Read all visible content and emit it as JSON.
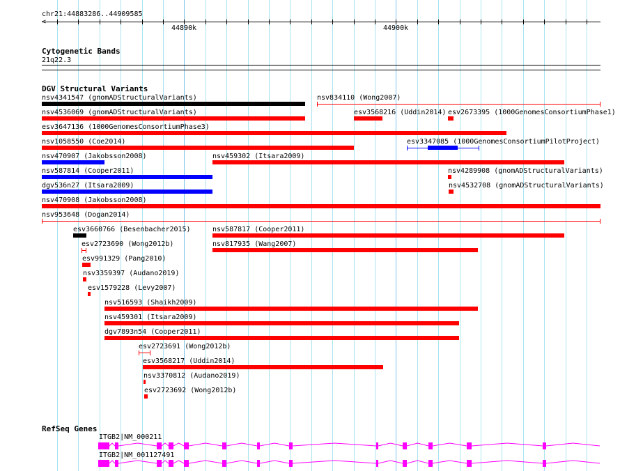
{
  "ruler": {
    "location": "chr21:44883286..44909585",
    "tick_labels": [
      "44890k",
      "44900k"
    ]
  },
  "tracks": {
    "cytoband": {
      "title": "Cytogenetic Bands",
      "band": "21q22.3"
    },
    "dgv": {
      "title": "DGV Structural Variants",
      "features": [
        "nsv4341547 (gnomADStructuralVariants)",
        "nsv834110 (Wong2007)",
        "nsv4536069 (gnomADStructuralVariants)",
        "esv3568216 (Uddin2014)",
        "esv2673395 (1000GenomesConsortiumPhase1)",
        "esv3647136 (1000GenomesConsortiumPhase3)",
        "nsv1058550 (Coe2014)",
        "esv3347085 (1000GenomesConsortiumPilotProject)",
        "nsv470907 (Jakobsson2008)",
        "nsv459302 (Itsara2009)",
        "nsv587814 (Cooper2011)",
        "nsv4289908 (gnomADStructuralVariants)",
        "dgv536n27 (Itsara2009)",
        "nsv4532708 (gnomADStructuralVariants)",
        "nsv470908 (Jakobsson2008)",
        "nsv953648 (Dogan2014)",
        "esv3660766 (Besenbacher2015)",
        "nsv587817 (Cooper2011)",
        "esv2723690 (Wong2012b)",
        "nsv817935 (Wang2007)",
        "esv991329 (Pang2010)",
        "nsv3359397 (Audano2019)",
        "esv1579228 (Levy2007)",
        "nsv516593 (Shaikh2009)",
        "nsv459301 (Itsara2009)",
        "dgv7893n54 (Cooper2011)",
        "esv2723691 (Wong2012b)",
        "esv3568217 (Uddin2014)",
        "nsv3370812 (Audano2019)",
        "esv2723692 (Wong2012b)"
      ]
    },
    "refseq": {
      "title": "RefSeq Genes",
      "genes": [
        "ITGB2|NM_000211",
        "ITGB2|NM_001127491"
      ]
    }
  },
  "colors": {
    "red": "#ff0000",
    "blue": "#0000ff",
    "black": "#000000",
    "gene": "#ff00ff",
    "grid": "#a8e4f0"
  }
}
